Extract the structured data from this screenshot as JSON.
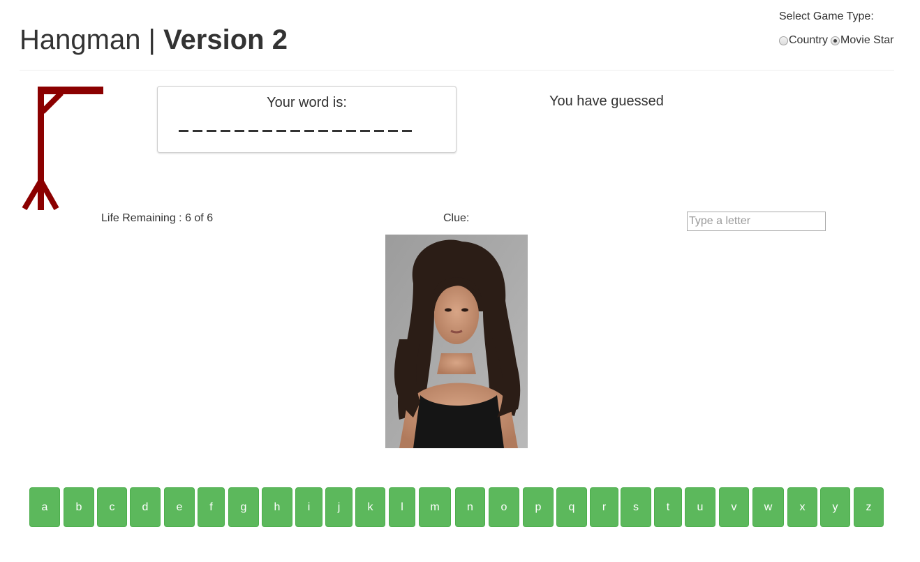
{
  "header": {
    "title_prefix": "Hangman | ",
    "title_bold": "Version 2"
  },
  "game_type": {
    "label": "Select Game Type:",
    "options": [
      {
        "label": "Country",
        "checked": false
      },
      {
        "label": "Movie Star",
        "checked": true
      }
    ]
  },
  "word": {
    "label": "Your word is:",
    "blank_count": 17
  },
  "guessed": {
    "label": "You have guessed"
  },
  "status": {
    "life_text": "Life Remaining : 6 of 6",
    "clue_label": "Clue:"
  },
  "input": {
    "placeholder": "Type a letter",
    "value": ""
  },
  "letters": [
    "a",
    "b",
    "c",
    "d",
    "e",
    "f",
    "g",
    "h",
    "i",
    "j",
    "k",
    "l",
    "m",
    "n",
    "o",
    "p",
    "q",
    "r",
    "s",
    "t",
    "u",
    "v",
    "w",
    "x",
    "y",
    "z"
  ],
  "colors": {
    "gallows": "#8b0000",
    "key_bg": "#5cb85c",
    "key_border": "#4cae4c"
  }
}
